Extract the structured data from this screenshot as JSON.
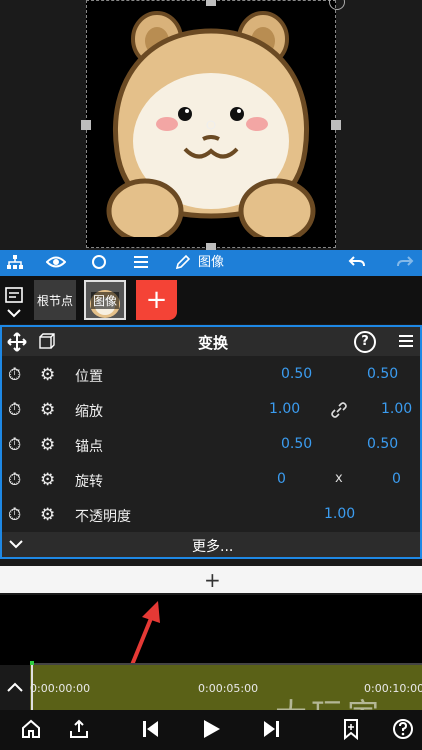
{
  "toolbar": {
    "image_label": "图像"
  },
  "layers": {
    "root_label": "根节点",
    "image_label": "图像",
    "add_label": "+"
  },
  "panel": {
    "title": "变换",
    "help_label": "?",
    "rows": [
      {
        "label": "位置",
        "val1": "0.50",
        "mid": "",
        "val2": "0.50"
      },
      {
        "label": "缩放",
        "val1": "1.00",
        "mid": "link",
        "val2": "1.00"
      },
      {
        "label": "锚点",
        "val1": "0.50",
        "mid": "",
        "val2": "0.50"
      },
      {
        "label": "旋转",
        "val1": "0",
        "mid": "x",
        "val2": "0"
      },
      {
        "label": "不透明度",
        "val1": "1.00",
        "mid": "",
        "val2": ""
      }
    ],
    "more_label": "更多..."
  },
  "addbar": {
    "label": "+"
  },
  "timeline": {
    "ticks": [
      "0:00:00:00",
      "0:00:05:00",
      "0:00:10:00"
    ]
  },
  "watermark": "大玩家",
  "colors": {
    "accent": "#1e88e5",
    "add_red": "#f44336",
    "value_blue": "#3b9cf0",
    "track": "#5a6117"
  }
}
